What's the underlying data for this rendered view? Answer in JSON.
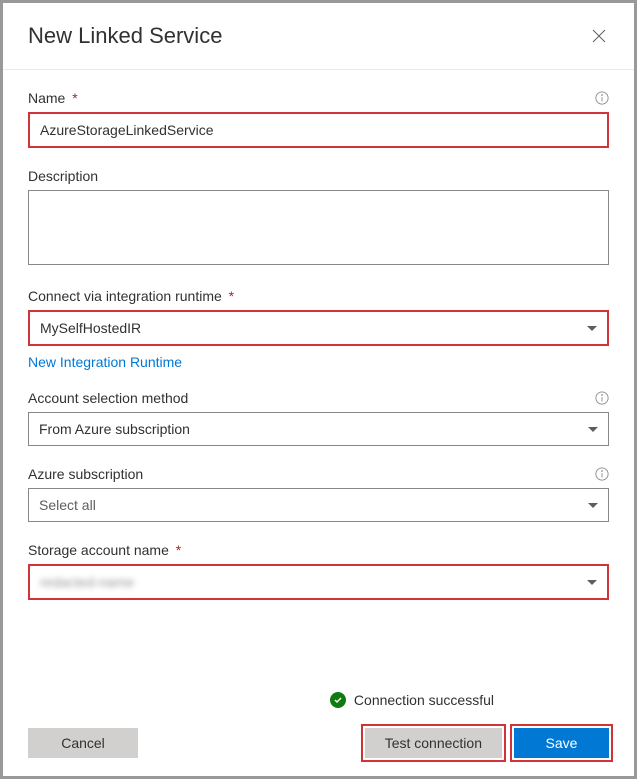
{
  "header": {
    "title": "New Linked Service"
  },
  "fields": {
    "name": {
      "label": "Name",
      "value": "AzureStorageLinkedService"
    },
    "description": {
      "label": "Description",
      "value": ""
    },
    "runtime": {
      "label": "Connect via integration runtime",
      "value": "MySelfHostedIR",
      "link": "New Integration Runtime"
    },
    "accountMethod": {
      "label": "Account selection method",
      "value": "From Azure subscription"
    },
    "subscription": {
      "label": "Azure subscription",
      "value": "Select all"
    },
    "storageAccount": {
      "label": "Storage account name",
      "value": "redacted-name"
    }
  },
  "status": {
    "text": "Connection successful"
  },
  "buttons": {
    "cancel": "Cancel",
    "test": "Test connection",
    "save": "Save"
  }
}
